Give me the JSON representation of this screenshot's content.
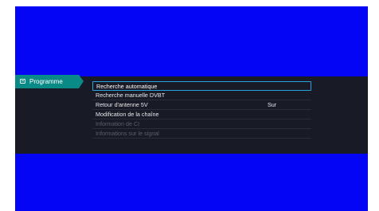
{
  "category_tab": {
    "icon": "channel-list-icon",
    "label": "Programme",
    "color": "#0a8a86"
  },
  "menu": {
    "items": [
      {
        "label": "Recherche automatique",
        "value": "",
        "state": "selected"
      },
      {
        "label": "Recherche manuelle DVBT",
        "value": "",
        "state": "normal"
      },
      {
        "label": "Retour d'antenne 5V",
        "value": "Sur",
        "state": "normal"
      },
      {
        "label": "Modification de la chaîne",
        "value": "",
        "state": "normal"
      },
      {
        "label": "Information de CI",
        "value": "",
        "state": "disabled"
      },
      {
        "label": "Informations sur le signal",
        "value": "",
        "state": "disabled"
      }
    ]
  },
  "colors": {
    "screen_background": "#0505f5",
    "menu_band": "#181a25",
    "selection_border": "#2aa3df",
    "disabled_text": "#5d5f6b"
  }
}
